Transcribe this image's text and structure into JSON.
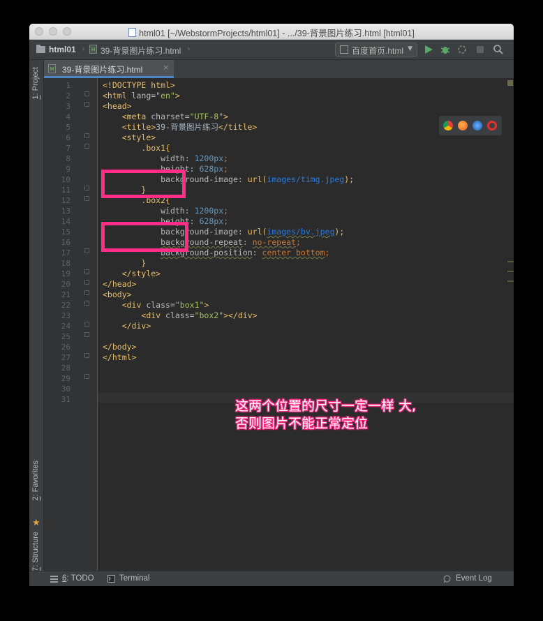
{
  "window": {
    "title": "html01 [~/WebstormProjects/html01] - .../39-背景图片练习.html [html01]"
  },
  "nav": {
    "project": "html01",
    "file": "39-背景图片练习.html",
    "run_config": "百度首页.html"
  },
  "left_tabs": {
    "project": {
      "num": "1",
      "label": ": Project"
    },
    "favorites": {
      "num": "2",
      "label": ": Favorites"
    },
    "structure": {
      "num": "7",
      "label": ": Structure"
    }
  },
  "editor_tab": {
    "label": "39-背景图片练习.html",
    "close": "×"
  },
  "line_numbers": [
    "1",
    "2",
    "3",
    "4",
    "5",
    "6",
    "7",
    "8",
    "9",
    "10",
    "11",
    "12",
    "13",
    "14",
    "15",
    "16",
    "17",
    "18",
    "19",
    "20",
    "21",
    "22",
    "23",
    "24",
    "25",
    "26",
    "27",
    "28",
    "29",
    "30",
    "31"
  ],
  "code": {
    "l1": "<!DOCTYPE html>",
    "l2_open": "<html ",
    "l2_attr": "lang=",
    "l2_val": "\"en\"",
    "l2_close": ">",
    "l3": "<head>",
    "l4_open": "<meta ",
    "l4_attr": "charset=",
    "l4_val": "\"UTF-8\"",
    "l4_close": ">",
    "l5_open": "<title>",
    "l5_text": "39-背景图片练习",
    "l5_close": "</title>",
    "l6": "<style>",
    "l7": ".box1{",
    "l8_prop": "width",
    "l8_val": "1200px",
    "l9_prop": "height",
    "l9_val": "628px",
    "l10_prop": "background-image",
    "l10_fn": "url(",
    "l10_url": "images/timg.jpeg",
    "l10_end": ");",
    "l11": "}",
    "l12": ".box2{",
    "l13_prop": "width",
    "l13_val": "1200px",
    "l14_prop": "height",
    "l14_val": "628px",
    "l15_prop": "background-image",
    "l15_fn": "url(",
    "l15_url": "images/bv.jpeg",
    "l15_end": ");",
    "l16_prop": "background-repeat",
    "l16_val": "no-repeat",
    "l17_prop": "background-position",
    "l17_val": "center bottom",
    "l18": "}",
    "l19": "</style>",
    "l20": "</head>",
    "l21": "<body>",
    "l22_open": "<div ",
    "l22_attr": "class=",
    "l22_val": "\"box1\"",
    "l22_close": ">",
    "l23_open": "<div ",
    "l23_attr": "class=",
    "l23_val": "\"box2\"",
    "l23_close": "></div>",
    "l24": "</div>",
    "l26": "</body>",
    "l27": "</html>"
  },
  "annotation": {
    "line1": "这两个位置的尺寸一定一样 大,",
    "line2": "否则图片不能正常定位"
  },
  "status": {
    "todo_num": "6",
    "todo_label": ": TODO",
    "terminal": "Terminal",
    "event_log": "Event Log"
  },
  "colors": {
    "annotation_pink": "#ff2d87",
    "editor_bg": "#2b2b2b",
    "tag_yellow": "#e8bf6a",
    "number_blue": "#6897bb",
    "string_green": "#a5c25c"
  }
}
